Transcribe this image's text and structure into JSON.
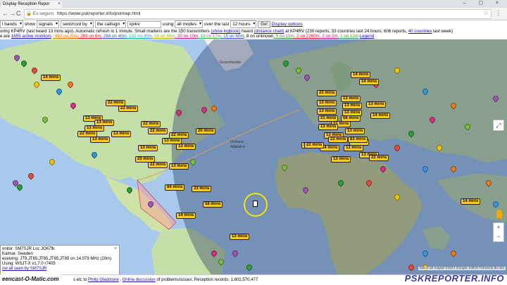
{
  "browser": {
    "tab_title": "Display Reception Repor",
    "tab_close": "×",
    "window_controls": "– ▢ ×",
    "back": "←",
    "forward": "→",
    "reload": "C",
    "secure_label": "Es seguro",
    "url": "https://www.pskreporter.info/pskmap.html",
    "star": "☆",
    "menu": "⋮"
  },
  "controls": {
    "bands": "l bands",
    "show_label": "show",
    "show_value": "signals",
    "sent_value": "sent/rcvd by",
    "callsign_value": "the callsign",
    "callsign_input": "kp4rv",
    "using_label": "using",
    "mode_value": "all modes",
    "over_label": "over the last",
    "time_value": "12 hours",
    "go": "Go!",
    "display_options": "Display options"
  },
  "info": {
    "line1_a": "oring KP4RV (last heard 13 mins ago). Automatic refresh in 1 minute. Small markers are the 150 transmitters",
    "line1_link1": "(show logbook)",
    "line1_b": "heard",
    "line1_link2": "(distance chart)",
    "line1_c": "at KP4RV (230 reports, 33 countries last 24 hours; 606 reports,",
    "line1_link3": "40 countries",
    "line1_d": "last week)",
    "line2_a": "e are",
    "line2_link1": "1655 active monitors",
    "line2_parts": [
      {
        "text": "697 on 20m",
        "color": "orange"
      },
      {
        "text": "283 on 6m",
        "color": "red"
      },
      {
        "text": "284 on 40m",
        "color": "blue"
      },
      {
        "text": "132 on 30m",
        "color": "cyan"
      },
      {
        "text": "58 on 80m",
        "color": "yellow"
      },
      {
        "text": "20 on 10m",
        "color": "mag"
      },
      {
        "text": "19 on 17m",
        "color": "lime"
      },
      {
        "text": "15 on 60m",
        "color": "blue"
      },
      {
        "text": "8 on unknown",
        "color": ""
      },
      {
        "text": "5 on 15m",
        "color": "green"
      },
      {
        "text": "2 on 2200m",
        "color": "red"
      },
      {
        "text": "2 on 2m",
        "color": "mag"
      },
      {
        "text": "1 on 12m",
        "color": "green"
      }
    ],
    "legend": "Legend"
  },
  "map": {
    "label_greenland": "Groenlandia",
    "label_ocean1": "Océano",
    "label_ocean2": "Atlántico",
    "labels": [
      "14 mins",
      "22 mins",
      "22 mins",
      "13 mins",
      "13 mins",
      "13 mins",
      "22 mins",
      "13 mins",
      "13 mins",
      "22 mins",
      "22 mins",
      "20 mins",
      "22 mins",
      "13 mins",
      "13 mins",
      "13 mins",
      "20 mins",
      "22 mins",
      "13 mins",
      "84 mins",
      "33 mins",
      "58 mins",
      "14 mins",
      "13 mins",
      "14 mins",
      "14 mins",
      "22 mins",
      "13 mins",
      "13 mins",
      "13 mins",
      "13 mins",
      "13 mins",
      "21 mins",
      "68 mins",
      "21 mins",
      "13 mins",
      "14 mins",
      "13 mins",
      "13 mins",
      "13 mins",
      "22 mins",
      "13 mins",
      "14 mins",
      "13 mins",
      "13 mins",
      "13 mins",
      "13 mins",
      "83 mins",
      "22 mins",
      "22 mins",
      "14 mins",
      "22 mins"
    ]
  },
  "popup": {
    "close": "×",
    "line1": "onitor: SM7SJR Loc JO67fb",
    "line2": "Kalmar, Sweden",
    "line3": "eceiving: JT9,JT65,JT65,JT65,JT65 on 14.079 MHz (20m)",
    "line4": "Using: WSJT-X v1.7.0 r7405",
    "line5": "ow all seen by SM7SJR"
  },
  "map_controls": {
    "zoom_in": "+",
    "zoom_out": "−",
    "fullscreen": "⤢",
    "google": "oogle",
    "credit": "Datos de mapas ©2017 Google, INEGI  Términos de uso"
  },
  "footer": {
    "text_a": "s etc to",
    "link1": "Philip Gladstone",
    "text_b": ".",
    "link2": "Online discussion",
    "text_c": "of problems/issues. Reception records: 1,602,570,477",
    "watermark_left": "eencast-O-Matic.com",
    "watermark_right": "PSKREPORTER.INFO"
  }
}
